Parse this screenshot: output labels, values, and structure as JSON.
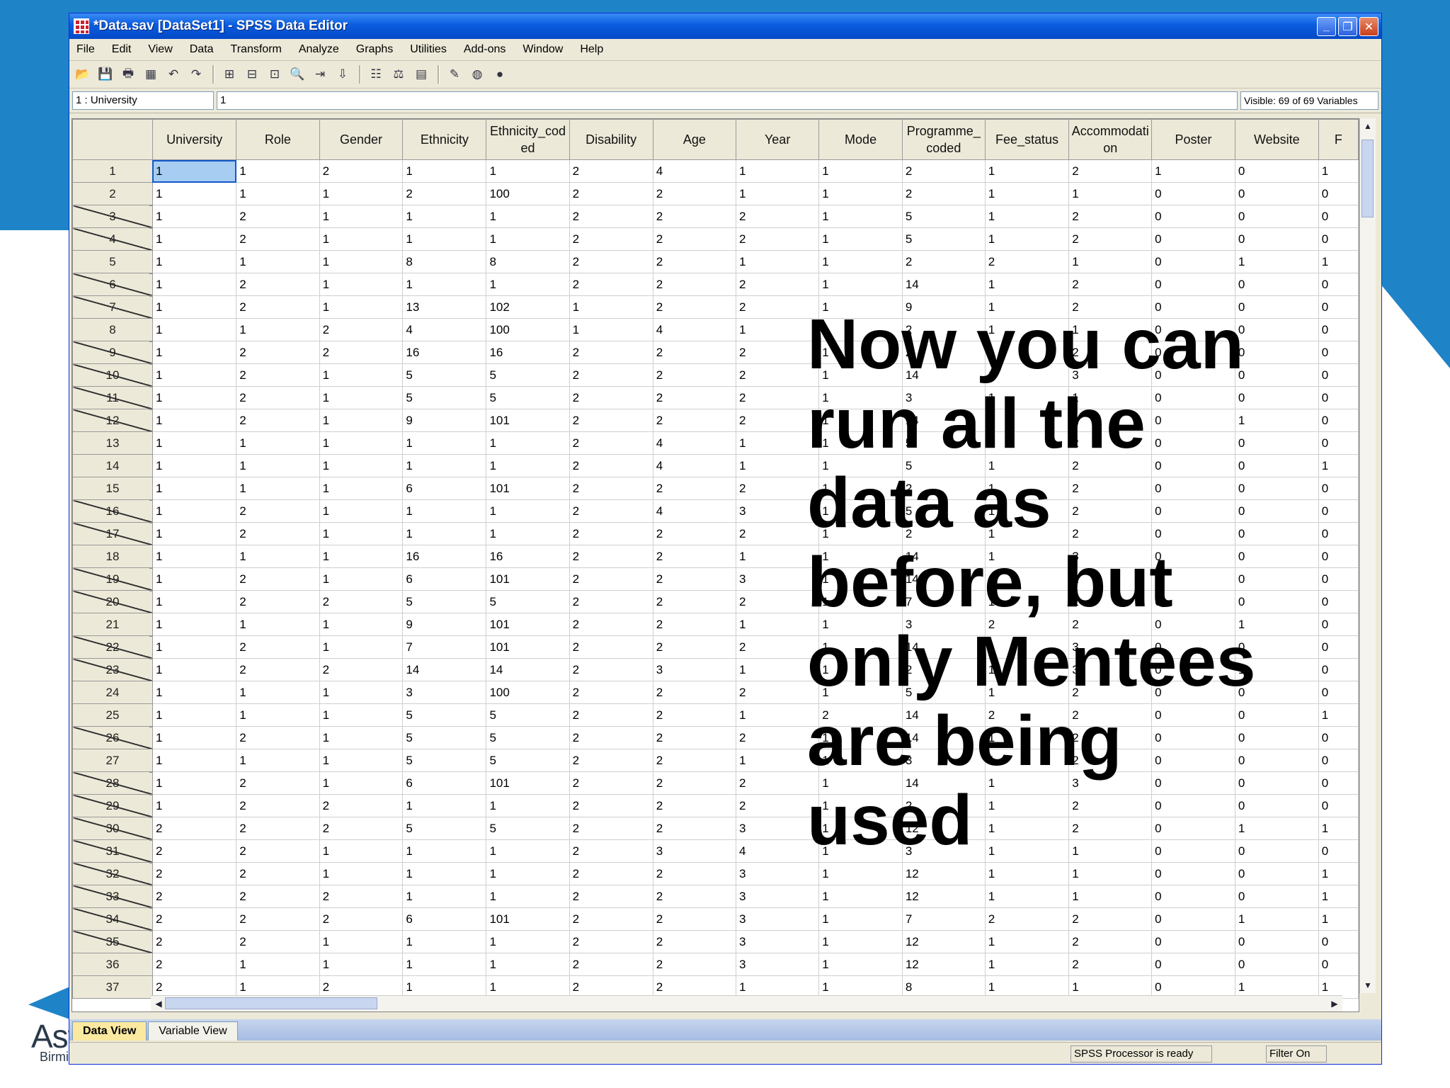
{
  "window": {
    "title": "*Data.sav [DataSet1] - SPSS Data Editor",
    "minimize_glyph": "_",
    "maximize_glyph": "❐",
    "close_glyph": "✕"
  },
  "menu": [
    "File",
    "Edit",
    "View",
    "Data",
    "Transform",
    "Analyze",
    "Graphs",
    "Utilities",
    "Add-ons",
    "Window",
    "Help"
  ],
  "cell_editor": {
    "reference": "1 : University",
    "value": "1",
    "visible_vars": "Visible: 69 of 69 Variables"
  },
  "columns": [
    "University",
    "Role",
    "Gender",
    "Ethnicity",
    "Ethnicity_coded",
    "Disability",
    "Age",
    "Year",
    "Mode",
    "Programme_coded",
    "Fee_status",
    "Accommodation",
    "Poster",
    "Website",
    "F"
  ],
  "rows": [
    {
      "n": "1",
      "f": false,
      "v": [
        "1",
        "1",
        "2",
        "1",
        "1",
        "2",
        "4",
        "1",
        "1",
        "2",
        "1",
        "2",
        "1",
        "0",
        "1"
      ]
    },
    {
      "n": "2",
      "f": false,
      "v": [
        "1",
        "1",
        "1",
        "2",
        "100",
        "2",
        "2",
        "1",
        "1",
        "2",
        "1",
        "1",
        "0",
        "0",
        "0"
      ]
    },
    {
      "n": "3",
      "f": true,
      "v": [
        "1",
        "2",
        "1",
        "1",
        "1",
        "2",
        "2",
        "2",
        "1",
        "5",
        "1",
        "2",
        "0",
        "0",
        "0"
      ]
    },
    {
      "n": "4",
      "f": true,
      "v": [
        "1",
        "2",
        "1",
        "1",
        "1",
        "2",
        "2",
        "2",
        "1",
        "5",
        "1",
        "2",
        "0",
        "0",
        "0"
      ]
    },
    {
      "n": "5",
      "f": false,
      "v": [
        "1",
        "1",
        "1",
        "8",
        "8",
        "2",
        "2",
        "1",
        "1",
        "2",
        "2",
        "1",
        "0",
        "1",
        "1"
      ]
    },
    {
      "n": "6",
      "f": true,
      "v": [
        "1",
        "2",
        "1",
        "1",
        "1",
        "2",
        "2",
        "2",
        "1",
        "14",
        "1",
        "2",
        "0",
        "0",
        "0"
      ]
    },
    {
      "n": "7",
      "f": true,
      "v": [
        "1",
        "2",
        "1",
        "13",
        "102",
        "1",
        "2",
        "2",
        "1",
        "9",
        "1",
        "2",
        "0",
        "0",
        "0"
      ]
    },
    {
      "n": "8",
      "f": false,
      "v": [
        "1",
        "1",
        "2",
        "4",
        "100",
        "1",
        "4",
        "1",
        "1",
        "2",
        "1",
        "1",
        "0",
        "0",
        "0"
      ]
    },
    {
      "n": "9",
      "f": true,
      "v": [
        "1",
        "2",
        "2",
        "16",
        "16",
        "2",
        "2",
        "2",
        "1",
        "2",
        "1",
        "2",
        "0",
        "0",
        "0"
      ]
    },
    {
      "n": "10",
      "f": true,
      "v": [
        "1",
        "2",
        "1",
        "5",
        "5",
        "2",
        "2",
        "2",
        "1",
        "14",
        "1",
        "3",
        "0",
        "0",
        "0"
      ]
    },
    {
      "n": "11",
      "f": true,
      "v": [
        "1",
        "2",
        "1",
        "5",
        "5",
        "2",
        "2",
        "2",
        "1",
        "3",
        "1",
        "1",
        "0",
        "0",
        "0"
      ]
    },
    {
      "n": "12",
      "f": true,
      "v": [
        "1",
        "2",
        "1",
        "9",
        "101",
        "2",
        "2",
        "2",
        "1",
        "14",
        "1",
        "2",
        "0",
        "1",
        "0"
      ]
    },
    {
      "n": "13",
      "f": false,
      "v": [
        "1",
        "1",
        "1",
        "1",
        "1",
        "2",
        "4",
        "1",
        "1",
        "5",
        "1",
        "2",
        "0",
        "0",
        "0"
      ]
    },
    {
      "n": "14",
      "f": false,
      "v": [
        "1",
        "1",
        "1",
        "1",
        "1",
        "2",
        "4",
        "1",
        "1",
        "5",
        "1",
        "2",
        "0",
        "0",
        "1"
      ]
    },
    {
      "n": "15",
      "f": false,
      "v": [
        "1",
        "1",
        "1",
        "6",
        "101",
        "2",
        "2",
        "2",
        "1",
        "2",
        "1",
        "2",
        "0",
        "0",
        "0"
      ]
    },
    {
      "n": "16",
      "f": true,
      "v": [
        "1",
        "2",
        "1",
        "1",
        "1",
        "2",
        "4",
        "3",
        "1",
        "5",
        "1",
        "2",
        "0",
        "0",
        "0"
      ]
    },
    {
      "n": "17",
      "f": true,
      "v": [
        "1",
        "2",
        "1",
        "1",
        "1",
        "2",
        "2",
        "2",
        "1",
        "2",
        "1",
        "2",
        "0",
        "0",
        "0"
      ]
    },
    {
      "n": "18",
      "f": false,
      "v": [
        "1",
        "1",
        "1",
        "16",
        "16",
        "2",
        "2",
        "1",
        "1",
        "14",
        "1",
        "3",
        "0",
        "0",
        "0"
      ]
    },
    {
      "n": "19",
      "f": true,
      "v": [
        "1",
        "2",
        "1",
        "6",
        "101",
        "2",
        "2",
        "3",
        "1",
        "14",
        "1",
        "2",
        "0",
        "0",
        "0"
      ]
    },
    {
      "n": "20",
      "f": true,
      "v": [
        "1",
        "2",
        "2",
        "5",
        "5",
        "2",
        "2",
        "2",
        "1",
        "7",
        "1",
        "2",
        "0",
        "0",
        "0"
      ]
    },
    {
      "n": "21",
      "f": false,
      "v": [
        "1",
        "1",
        "1",
        "9",
        "101",
        "2",
        "2",
        "1",
        "1",
        "3",
        "2",
        "2",
        "0",
        "1",
        "0"
      ]
    },
    {
      "n": "22",
      "f": true,
      "v": [
        "1",
        "2",
        "1",
        "7",
        "101",
        "2",
        "2",
        "2",
        "1",
        "14",
        "1",
        "3",
        "0",
        "0",
        "0"
      ]
    },
    {
      "n": "23",
      "f": true,
      "v": [
        "1",
        "2",
        "2",
        "14",
        "14",
        "2",
        "3",
        "1",
        "1",
        "2",
        "1",
        "3",
        "0",
        "1",
        "0"
      ]
    },
    {
      "n": "24",
      "f": false,
      "v": [
        "1",
        "1",
        "1",
        "3",
        "100",
        "2",
        "2",
        "2",
        "1",
        "5",
        "1",
        "2",
        "0",
        "0",
        "0"
      ]
    },
    {
      "n": "25",
      "f": false,
      "v": [
        "1",
        "1",
        "1",
        "5",
        "5",
        "2",
        "2",
        "1",
        "2",
        "14",
        "2",
        "2",
        "0",
        "0",
        "1"
      ]
    },
    {
      "n": "26",
      "f": true,
      "v": [
        "1",
        "2",
        "1",
        "5",
        "5",
        "2",
        "2",
        "2",
        "1",
        "14",
        "1",
        "2",
        "0",
        "0",
        "0"
      ]
    },
    {
      "n": "27",
      "f": false,
      "v": [
        "1",
        "1",
        "1",
        "5",
        "5",
        "2",
        "2",
        "1",
        "1",
        "3",
        "1",
        "2",
        "0",
        "0",
        "0"
      ]
    },
    {
      "n": "28",
      "f": true,
      "v": [
        "1",
        "2",
        "1",
        "6",
        "101",
        "2",
        "2",
        "2",
        "1",
        "14",
        "1",
        "3",
        "0",
        "0",
        "0"
      ]
    },
    {
      "n": "29",
      "f": true,
      "v": [
        "1",
        "2",
        "2",
        "1",
        "1",
        "2",
        "2",
        "2",
        "1",
        "2",
        "1",
        "2",
        "0",
        "0",
        "0"
      ]
    },
    {
      "n": "30",
      "f": true,
      "v": [
        "2",
        "2",
        "2",
        "5",
        "5",
        "2",
        "2",
        "3",
        "1",
        "12",
        "1",
        "2",
        "0",
        "1",
        "1"
      ]
    },
    {
      "n": "31",
      "f": true,
      "v": [
        "2",
        "2",
        "1",
        "1",
        "1",
        "2",
        "3",
        "4",
        "1",
        "3",
        "1",
        "1",
        "0",
        "0",
        "0"
      ]
    },
    {
      "n": "32",
      "f": true,
      "v": [
        "2",
        "2",
        "1",
        "1",
        "1",
        "2",
        "2",
        "3",
        "1",
        "12",
        "1",
        "1",
        "0",
        "0",
        "1"
      ]
    },
    {
      "n": "33",
      "f": true,
      "v": [
        "2",
        "2",
        "2",
        "1",
        "1",
        "2",
        "2",
        "3",
        "1",
        "12",
        "1",
        "1",
        "0",
        "0",
        "1"
      ]
    },
    {
      "n": "34",
      "f": true,
      "v": [
        "2",
        "2",
        "2",
        "6",
        "101",
        "2",
        "2",
        "3",
        "1",
        "7",
        "2",
        "2",
        "0",
        "1",
        "1"
      ]
    },
    {
      "n": "35",
      "f": true,
      "v": [
        "2",
        "2",
        "1",
        "1",
        "1",
        "2",
        "2",
        "3",
        "1",
        "12",
        "1",
        "2",
        "0",
        "0",
        "0"
      ]
    },
    {
      "n": "36",
      "f": false,
      "v": [
        "2",
        "1",
        "1",
        "1",
        "1",
        "2",
        "2",
        "3",
        "1",
        "12",
        "1",
        "2",
        "0",
        "0",
        "0"
      ]
    },
    {
      "n": "37",
      "f": false,
      "v": [
        "2",
        "1",
        "2",
        "1",
        "1",
        "2",
        "2",
        "1",
        "1",
        "8",
        "1",
        "1",
        "0",
        "1",
        "1"
      ]
    }
  ],
  "tabs": {
    "data_view": "Data View",
    "variable_view": "Variable View"
  },
  "status": {
    "processor": "SPSS  Processor is ready",
    "filter": "Filter On"
  },
  "overlay_text": "Now you can run all the data as before, but only Mentees are being used",
  "branding": {
    "logo": "Ast",
    "logo_sub": "Birmi"
  }
}
